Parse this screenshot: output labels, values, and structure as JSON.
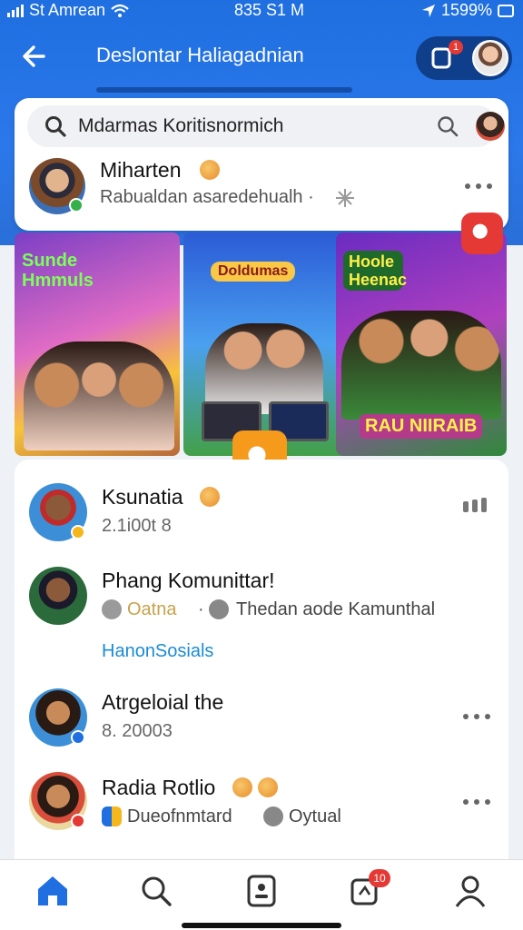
{
  "status_bar": {
    "carrier": "St Amrean",
    "time": "835 S1  M",
    "battery": "1599%"
  },
  "header": {
    "title": "Deslontar Haliagadnian",
    "notification_count": "1"
  },
  "search": {
    "value": "Mdarmas Koritisnormich"
  },
  "top_item": {
    "name": "Miharten",
    "subtitle": "Rabualdan asaredehualh ·"
  },
  "tiles": [
    {
      "caption": "Sunde Hmmuls"
    },
    {
      "caption": "Doldumas"
    },
    {
      "caption": "Hoole Heenac",
      "footer": "RAU NIIRAIB"
    }
  ],
  "list": [
    {
      "name": "Ksunatia",
      "subtitle": "2.1i00t 8"
    },
    {
      "name": "Phang Komunittar!",
      "tag1": "Oatna",
      "sep": "·",
      "tag2": "Thedan aode Kamunthal",
      "link": "HanonSosials"
    },
    {
      "name": "Atrgeloial the",
      "subtitle": "8. 20003"
    },
    {
      "name": "Radia Rotlio",
      "tag1": "Dueofnmtard",
      "tag2": "Oytual"
    }
  ],
  "tab_bar": {
    "badge": "10"
  },
  "colors": {
    "header_blue": "#1f6fe0",
    "link_blue": "#1a8bd6",
    "badge_red": "#e53935"
  }
}
